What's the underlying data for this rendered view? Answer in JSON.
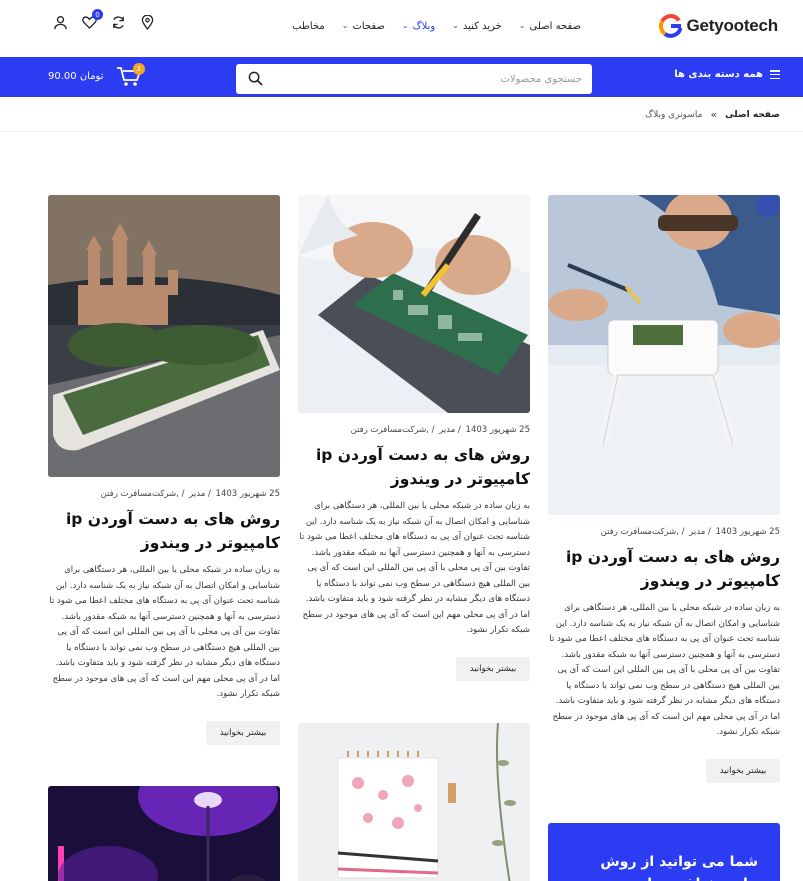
{
  "header": {
    "logo_text": "Getyootech",
    "nav": [
      {
        "label": "صفحه اصلی",
        "has_dropdown": true,
        "active": false
      },
      {
        "label": "خرید کنید",
        "has_dropdown": true,
        "active": false
      },
      {
        "label": "وبلاگ",
        "has_dropdown": true,
        "active": true
      },
      {
        "label": "صفحات",
        "has_dropdown": true,
        "active": false
      },
      {
        "label": "مخاطب",
        "has_dropdown": false,
        "active": false
      }
    ],
    "icons": {
      "location": "location-pin-icon",
      "compare": "compare-arrows-icon",
      "wishlist": "heart-icon",
      "account": "user-icon"
    },
    "wishlist_count": "0"
  },
  "bluebar": {
    "categories_label": "همه دسته بندی ها",
    "search_placeholder": "جستجوی محصولات",
    "cart_total": "90.00 تومان",
    "cart_count": "3"
  },
  "breadcrumb": {
    "home": "صفحه اصلی",
    "separator": "»",
    "current": "ماسونری وبلاگ"
  },
  "posts": [
    {
      "image": "drone-repair-photo",
      "date": "25 شهریور 1403",
      "author": "مدیر",
      "category": ",شرکت‌مسافرت رفتن",
      "title": "روش های به دست آوردن ip کامپیوتر در ویندوز",
      "excerpt": "به زبان ساده در شبکه محلی یا بین المللی، هر دستگاهی برای شناسایی و امکان اتصال به آن شبکه نیاز به یک شناسه دارد. این شناسه تحت عنوان آی پی به دستگاه های مختلف اعطا می شود تا دسترسی به آنها و همچنین دسترسی آنها به شبکه مقدور باشد. تفاوت بین آی پی محلی با آی پی بین المللی این است که آی پی بین المللی هیچ دستگاهی در سطح وب نمی تواند با دستگاه یا دستگاه های دیگر مشابه در نظر گرفته شود و باید متفاوت باشد. اما در آی پی محلی مهم این است که آی پی های موجود در سطح شبکه تکرار نشود.",
      "button": "بیشتر بخوانید"
    },
    {
      "image": "circuit-board-soldering-photo",
      "date": "25 شهریور 1403",
      "author": "مدیر",
      "category": ",شرکت‌مسافرت رفتن",
      "title": "روش های به دست آوردن ip کامپیوتر در ویندوز",
      "excerpt": "به زبان ساده در شبکه محلی یا بین المللی، هر دستگاهی برای شناسایی و امکان اتصال به آن شبکه نیاز به یک شناسه دارد. این شناسه تحت عنوان آی پی به دستگاه های مختلف اعطا می شود تا دسترسی به آنها و همچنین دسترسی آنها به شبکه مقدور باشد. تفاوت بین آی پی محلی با آی پی بین المللی این است که آی پی بین المللی هیچ دستگاهی در سطح وب نمی تواند با دستگاه یا دستگاه های دیگر مشابه در نظر گرفته شود و باید متفاوت باشد. اما در آی پی محلی مهم این است که آی پی های موجود در سطح شبکه تکرار نشود.",
      "button": "بیشتر بخوانید"
    },
    {
      "image": "castle-on-phone-photo",
      "date": "25 شهریور 1403",
      "author": "مدیر",
      "category": ",شرکت‌مسافرت رفتن",
      "title": "روش های به دست آوردن ip کامپیوتر در ویندوز",
      "excerpt": "به زبان ساده در شبکه محلی یا بین المللی، هر دستگاهی برای شناسایی و امکان اتصال به آن شبکه نیاز به یک شناسه دارد. این شناسه تحت عنوان آی پی به دستگاه های مختلف اعطا می شود تا دسترسی به آنها و همچنین دسترسی آنها به شبکه مقدور باشد. تفاوت بین آی پی محلی با آی پی بین المللی این است که آی پی بین المللی هیچ دستگاهی در سطح وب نمی تواند با دستگاه یا دستگاه های دیگر مشابه در نظر گرفته شود و باید متفاوت باشد. اما در آی پی محلی مهم این است که آی پی های موجود در سطح شبکه تکرار نشود.",
      "button": "بیشتر بخوانید"
    }
  ],
  "extra_images": [
    "notebook-desk-photo",
    "purple-neon-lamp-photo"
  ],
  "promo": {
    "text": "شما می توانید از روش های مختلفی برای به دست آوردن"
  },
  "colors": {
    "brand_blue": "#2b3cf2",
    "cart_badge": "#f5a623",
    "button_bg": "#f1f1f1"
  }
}
